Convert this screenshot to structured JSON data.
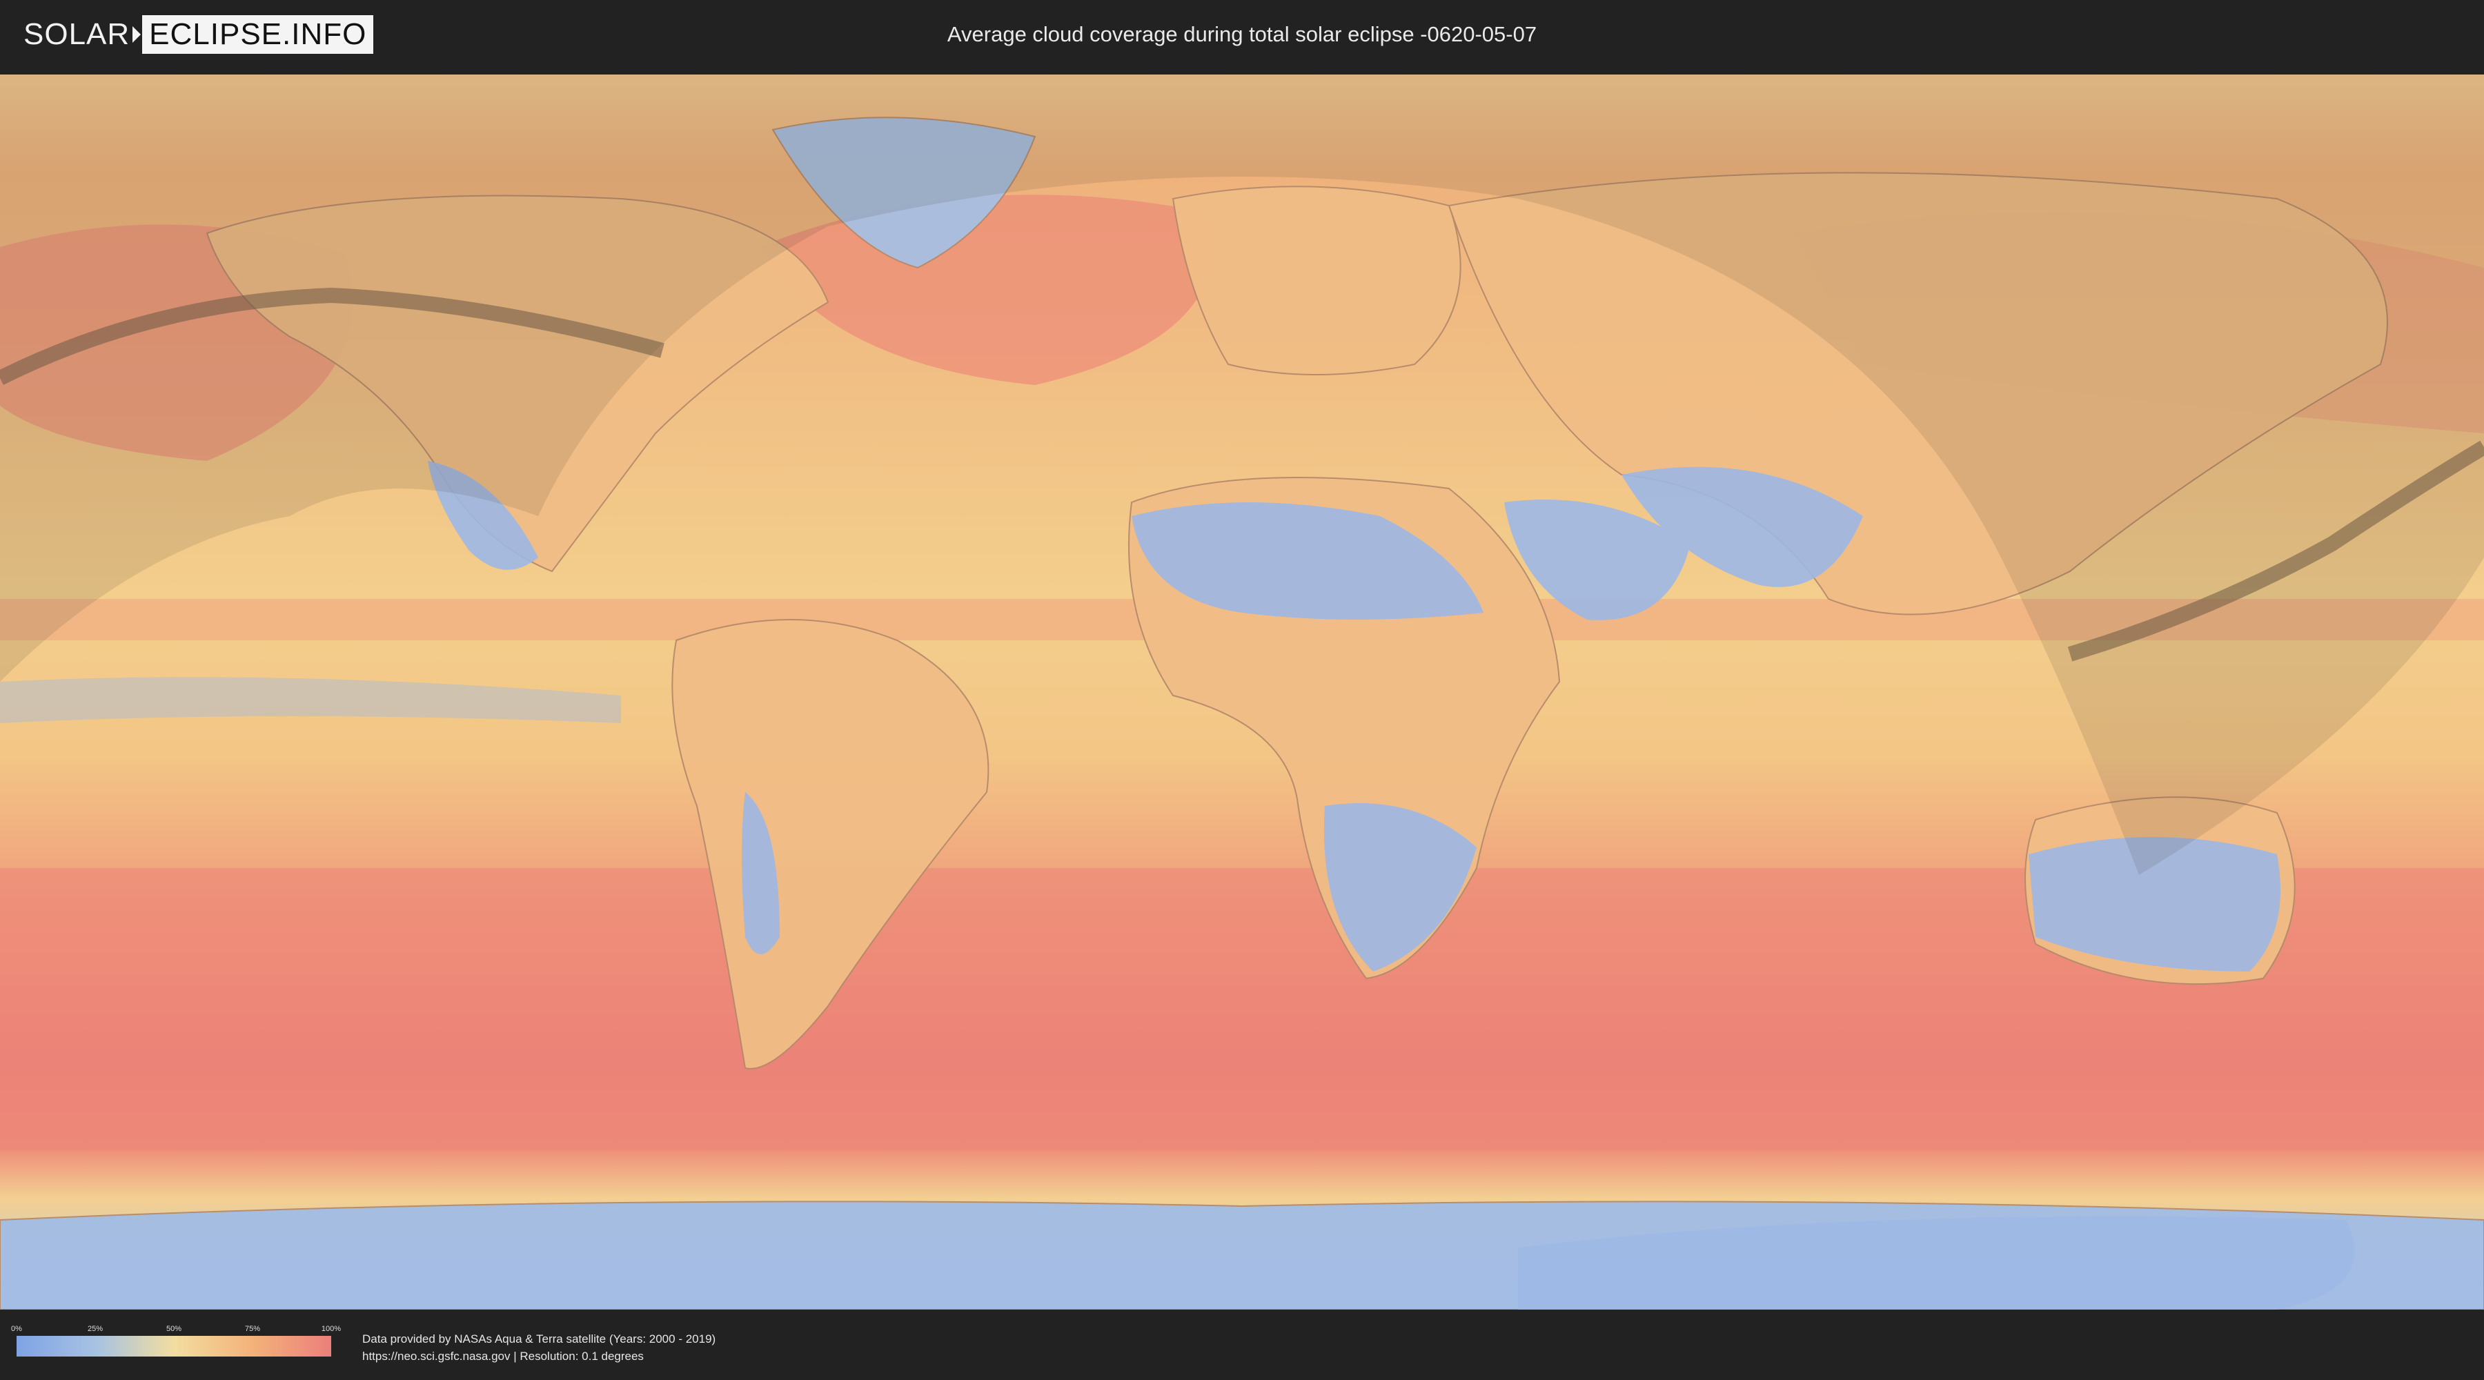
{
  "header": {
    "logo_solar": "SOLAR",
    "logo_eclipse": "ECLIPSE.INFO",
    "title": "Average cloud coverage during total solar eclipse -0620-05-07"
  },
  "legend": {
    "ticks": [
      "0%",
      "25%",
      "50%",
      "75%",
      "100%"
    ],
    "colors": [
      "#7fa3e4",
      "#a6c2e3",
      "#f2dda0",
      "#f3b27a",
      "#ec7f7b"
    ]
  },
  "footer": {
    "credit_line1": "Data provided by NASAs Aqua & Terra satellite (Years: 2000 - 2019)",
    "credit_line2": "https://neo.sci.gsfc.nasa.gov | Resolution: 0.1 degrees"
  },
  "map": {
    "ocean_color": "#f2c083",
    "high_cloud_color": "#ec8578",
    "low_cloud_color": "#9cb8e6",
    "path_color": "#6b5a44",
    "visibility_shade": "#3a3028"
  }
}
